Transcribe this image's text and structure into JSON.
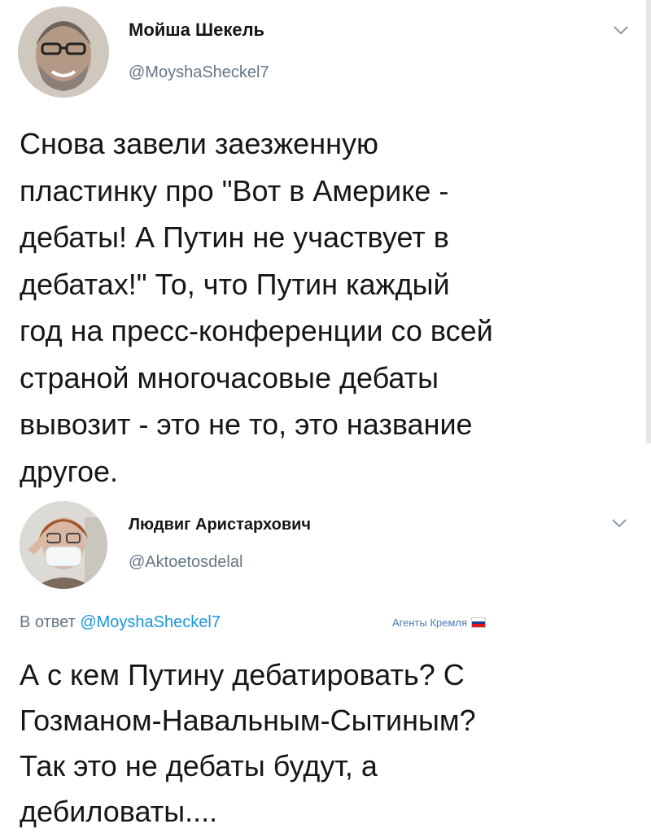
{
  "tweet1": {
    "author_name": "Мойша Шекель",
    "handle": "@MoyshaSheckel7",
    "text": "Снова завели заезженную\nпластинку про \"Вот в Америке -\nдебаты! А Путин не участвует в\nдебатах!\" То, что Путин каждый\nгод на пресс-конференции со всей\nстраной многочасовые дебаты\nвывозит - это не то, это название\nдругое.",
    "avatar_icon": "portrait-photo-icon",
    "menu_icon": "chevron-down-icon"
  },
  "tweet2": {
    "author_name": "Людвиг Аристархович",
    "handle": "@Aktoetosdelal",
    "reply_prefix": "В ответ",
    "reply_to": "@MoyshaSheckel7",
    "badge": "Агенты Кремля",
    "flag_colors": [
      "#ffffff",
      "#1c3f95",
      "#e4181c"
    ],
    "text": "А с кем Путину дебатировать? С\nГозманом-Навальным-Сытиным?\nТак это не дебаты будут, а\nдебиловаты....",
    "avatar_icon": "portrait-photo-icon",
    "menu_icon": "chevron-down-icon"
  },
  "colors": {
    "text": "#14171a",
    "secondary": "#657786",
    "link": "#1b95e0"
  }
}
